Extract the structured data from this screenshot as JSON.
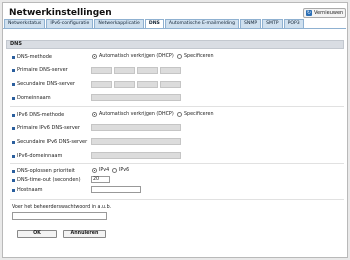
{
  "page": {
    "title": "Netwerkinstellingen",
    "refresh_label": "Vernieuwen"
  },
  "tabs": [
    "Netwerkstatus",
    "IPv6-configuratie",
    "Netwerkapplicatie",
    "DNS",
    "Automatische E-mailmelding",
    "SNMP",
    "SMTP",
    "POP3"
  ],
  "section": {
    "dns": "DNS"
  },
  "fields": {
    "dns_method": "DNS-methode",
    "primary_dns": "Primaire DNS-server",
    "secondary_dns": "Secundaire DNS-server",
    "domain_name": "Domeinnaam",
    "ipv6_dns_method": "IPv6 DNS-methode",
    "primary_ipv6_dns": "Primaire IPv6 DNS-server",
    "secondary_ipv6_dns": "Secundaire IPv6 DNS-server",
    "ipv6_domain": "IPv6-domeinnaam",
    "resolution_priority": "DNS-oplossen prioriteit",
    "timeout": "DNS-time-out (seconden)",
    "hostname": "Hostnaam"
  },
  "options": {
    "auto_dhcp": "Automatisch verkrijgen (DHCP)",
    "specify": "Specificeren",
    "ipv4": "IPv4",
    "ipv6": "IPv6"
  },
  "values": {
    "timeout": "20"
  },
  "password": {
    "label": "Voer het beheerderswachtwoord in a.u.b."
  },
  "buttons": {
    "ok": "OK",
    "cancel": "Annuleren"
  }
}
